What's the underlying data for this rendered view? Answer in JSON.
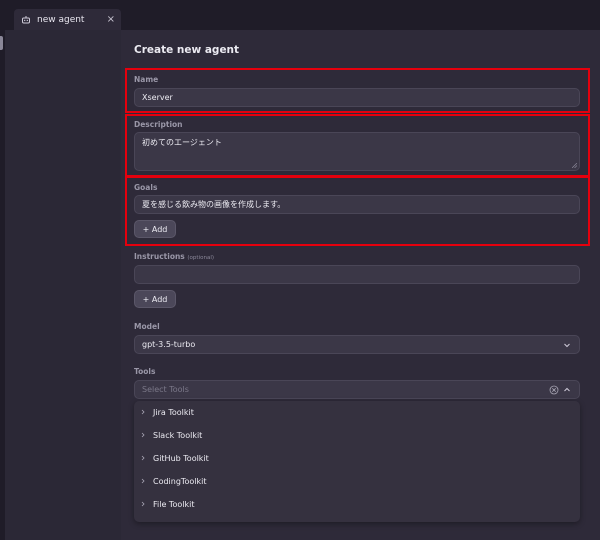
{
  "tab": {
    "label": "new agent",
    "close": "×"
  },
  "form": {
    "title": "Create new agent",
    "name": {
      "label": "Name",
      "value": "Xserver"
    },
    "description": {
      "label": "Description",
      "value": "初めてのエージェント"
    },
    "goals": {
      "label": "Goals",
      "value": "夏を感じる飲み物の画像を作成します。",
      "add_label": "+ Add"
    },
    "instructions": {
      "label": "Instructions",
      "optional": "(optional)",
      "value": "",
      "add_label": "+ Add"
    },
    "model": {
      "label": "Model",
      "value": "gpt-3.5-turbo"
    },
    "tools": {
      "label": "Tools",
      "placeholder": "Select Tools",
      "options": [
        "Jira Toolkit",
        "Slack Toolkit",
        "GitHub Toolkit",
        "CodingToolkit",
        "File Toolkit"
      ]
    }
  },
  "highlights": {
    "color": "#e5000d"
  },
  "icons": {
    "tab": "robot-icon",
    "close": "close-icon",
    "chevron_down": "chevron-down-icon",
    "chevron_up": "chevron-up-icon",
    "clear": "clear-circle-icon",
    "chevron_right": "chevron-right-icon"
  }
}
